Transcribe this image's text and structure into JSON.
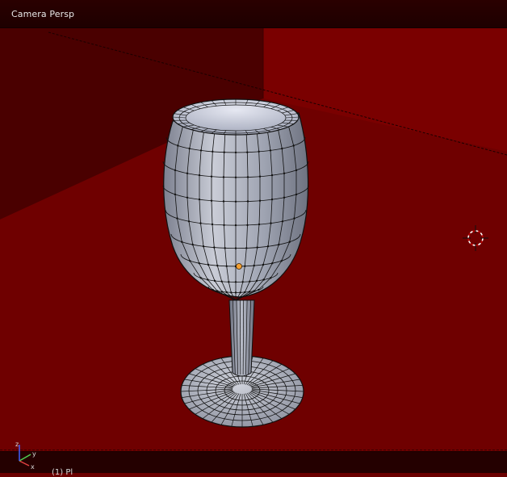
{
  "viewport": {
    "title": "Camera Persp",
    "object_label": "(1) Pl",
    "background_color": "#6b0000",
    "mesh_color": "#a3a8b8",
    "wire_color": "#111111",
    "origin_color": "#f5a030"
  },
  "gizmo": {
    "axes": [
      "x",
      "y",
      "z"
    ],
    "axis_colors": {
      "x": "#e04040",
      "y": "#50d050",
      "z": "#4060ff"
    }
  },
  "icons": {
    "cursor": "3d-cursor-icon",
    "axes": "axis-gizmo-icon"
  }
}
